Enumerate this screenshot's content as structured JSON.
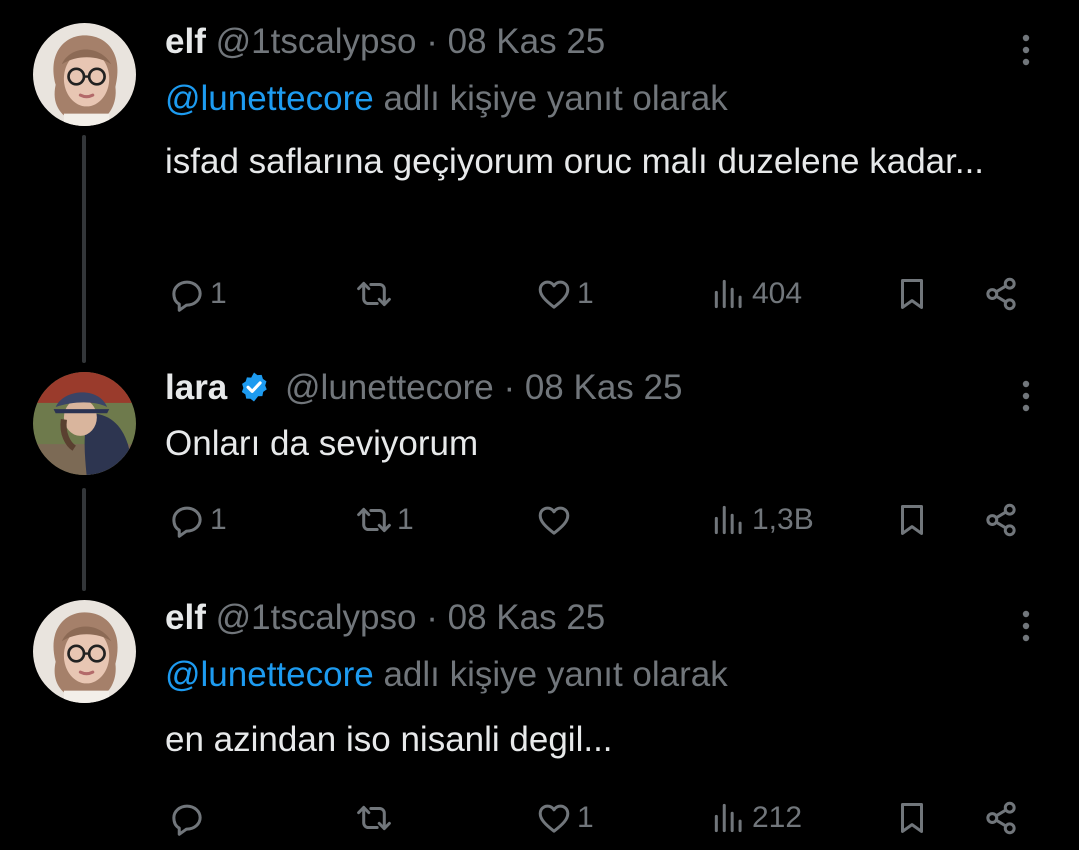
{
  "tweets": [
    {
      "name": "elf",
      "handle": "@1tscalypso",
      "separator": "·",
      "date": "08 Kas 25",
      "reply_mention": "@lunettecore",
      "reply_suffix": "adlı kişiye yanıt olarak",
      "text": "isfad saflarına geçiyorum oruc malı duzelene kadar...",
      "replies": "1",
      "retweets": "",
      "likes": "1",
      "views": "404",
      "avatar": "woman-with-glasses-avatar"
    },
    {
      "name": "lara",
      "verified": true,
      "handle": "@lunettecore",
      "separator": "·",
      "date": "08 Kas 25",
      "text": "Onları da seviyorum",
      "replies": "1",
      "retweets": "1",
      "likes": "",
      "views": "1,3B",
      "avatar": "person-with-cap-avatar"
    },
    {
      "name": "elf",
      "handle": "@1tscalypso",
      "separator": "·",
      "date": "08 Kas 25",
      "reply_mention": "@lunettecore",
      "reply_suffix": "adlı kişiye yanıt olarak",
      "text": "en azindan iso nisanli degil...",
      "replies": "",
      "retweets": "",
      "likes": "1",
      "views": "212",
      "avatar": "woman-with-glasses-avatar"
    }
  ],
  "colors": {
    "background": "#000000",
    "text": "#e7e9ea",
    "muted": "#71767b",
    "link": "#1d9bf0",
    "verified": "#1d9bf0",
    "thread_line": "#333639"
  },
  "icons": {
    "reply": "reply-icon",
    "retweet": "retweet-icon",
    "like": "heart-icon",
    "views": "views-icon",
    "bookmark": "bookmark-icon",
    "share": "share-icon",
    "more": "more-vertical-icon",
    "verified": "verified-badge-icon"
  }
}
